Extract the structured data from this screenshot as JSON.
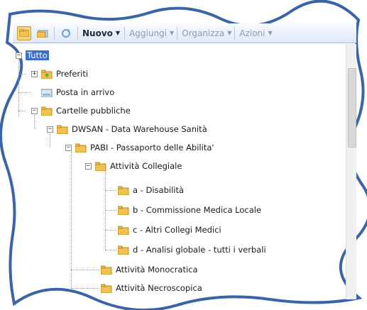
{
  "toolbar": {
    "nuovo_label": "Nuovo",
    "aggiungi_label": "Aggiungi",
    "organizza_label": "Organizza",
    "azioni_label": "Azioni"
  },
  "tree": {
    "root": "Tutto",
    "preferiti": "Preferiti",
    "posta": "Posta in arrivo",
    "cartelle": "Cartelle pubbliche",
    "dwsan": "DWSAN - Data Warehouse Sanità",
    "pabi": "PABI - Passaporto delle Abilita'",
    "collegiale": "Attività Collegiale",
    "a": "a - Disabilità",
    "b": "b - Commissione Medica Locale",
    "c": "c - Altri Collegi Medici",
    "d": "d - Analisi globale - tutti i verbali",
    "monocratica": "Attività Monocratica",
    "necroscopica": "Attività Necroscopica"
  },
  "colors": {
    "selection": "#3a6fc4",
    "folder": "#f2c24f",
    "frame": "#3b63a8"
  }
}
